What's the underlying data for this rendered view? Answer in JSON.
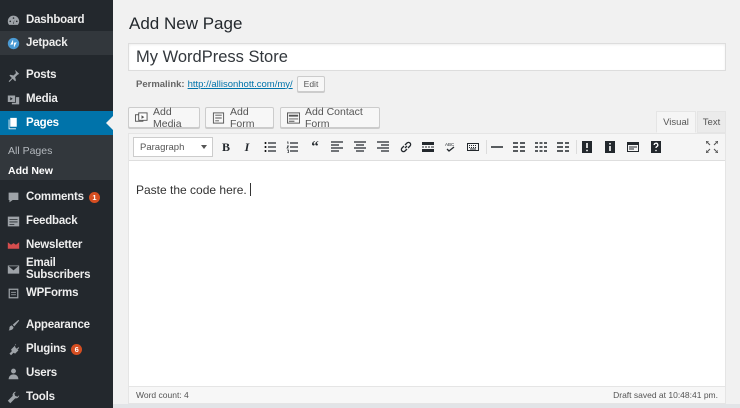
{
  "sidebar": {
    "items": [
      {
        "label": "Dashboard",
        "icon": "dashboard-icon"
      },
      {
        "label": "Jetpack",
        "icon": "jetpack-icon"
      },
      {
        "label": "Posts",
        "icon": "pin-icon"
      },
      {
        "label": "Media",
        "icon": "media-icon"
      },
      {
        "label": "Pages",
        "icon": "pages-icon"
      },
      {
        "label": "Comments",
        "icon": "comment-icon",
        "badge": "1"
      },
      {
        "label": "Feedback",
        "icon": "feedback-icon"
      },
      {
        "label": "Newsletter",
        "icon": "newsletter-icon"
      },
      {
        "label": "Email Subscribers",
        "icon": "email-icon"
      },
      {
        "label": "WPForms",
        "icon": "wpforms-icon"
      },
      {
        "label": "Appearance",
        "icon": "brush-icon"
      },
      {
        "label": "Plugins",
        "icon": "plugin-icon",
        "badge": "6"
      },
      {
        "label": "Users",
        "icon": "users-icon"
      },
      {
        "label": "Tools",
        "icon": "wrench-icon"
      }
    ],
    "submenu": {
      "all_pages": "All Pages",
      "add_new": "Add New"
    }
  },
  "main": {
    "title": "Add New Page",
    "post_title": "My WordPress Store",
    "permalink": {
      "label": "Permalink:",
      "url": "http://allisonhott.com/my/",
      "edit": "Edit"
    },
    "media_buttons": {
      "add_media": "Add Media",
      "add_form": "Add Form",
      "add_contact_form": "Add Contact Form"
    },
    "tabs": {
      "visual": "Visual",
      "text": "Text"
    },
    "toolbar": {
      "format": "Paragraph"
    },
    "content": "Paste the code here.",
    "status": {
      "word_count": "Word count: 4",
      "draft_saved": "Draft saved at 10:48:41 pm."
    }
  },
  "colors": {
    "sidebar_bg": "#23282d",
    "accent": "#0073aa",
    "badge": "#d54e21"
  }
}
